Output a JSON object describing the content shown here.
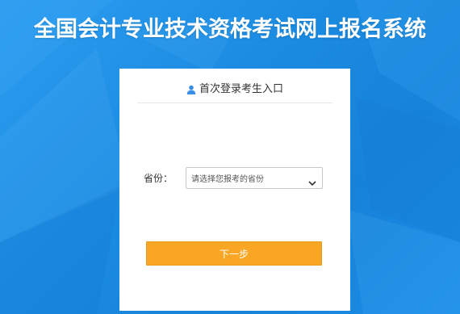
{
  "page": {
    "title": "全国会计专业技术资格考试网上报名系统"
  },
  "login_card": {
    "header_icon": "user-icon",
    "header_text": "首次登录考生入口",
    "province_label": "省份：",
    "province_select_value": "请选择您报考的省份",
    "chevron_icon": "chevron-down-icon",
    "next_button_label": "下一步"
  },
  "colors": {
    "background": "#1f8fe3",
    "button": "#f8a624",
    "card": "#ffffff",
    "icon": "#3a8ee6"
  }
}
